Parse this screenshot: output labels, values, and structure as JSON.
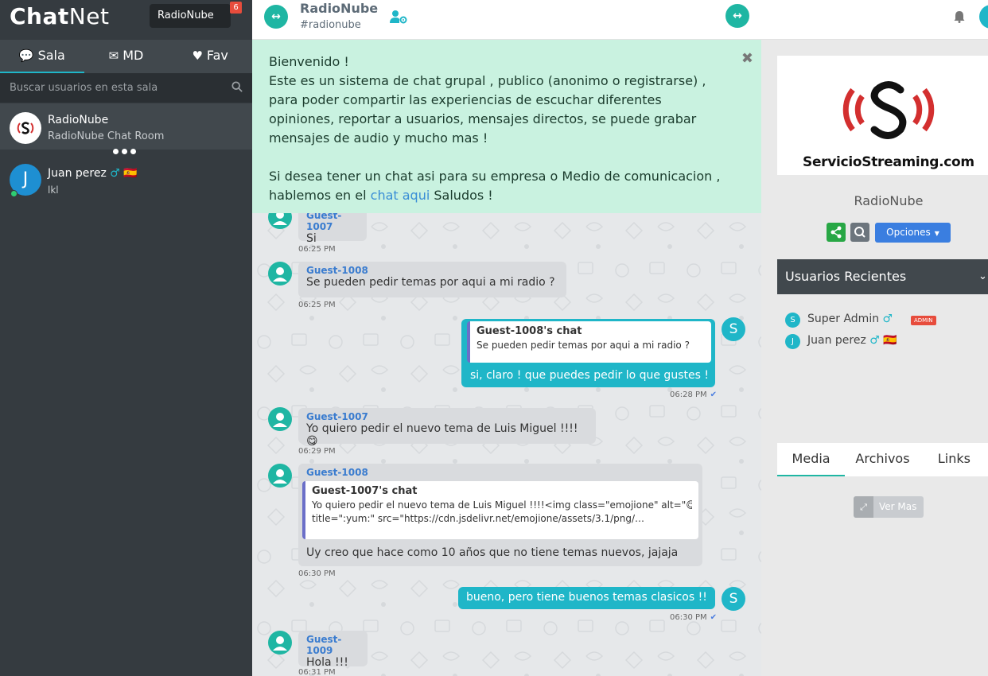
{
  "brand": {
    "part1": "Chat",
    "part2": "Net"
  },
  "room_pill": {
    "label": "RadioNube",
    "badge": "6"
  },
  "sidebar": {
    "tabs": [
      {
        "label": "Sala",
        "icon": "comments-icon"
      },
      {
        "label": "MD",
        "icon": "envelope-icon"
      },
      {
        "label": "Fav",
        "icon": "heart-icon"
      }
    ],
    "search_placeholder": "Buscar usuarios en esta sala",
    "room": {
      "name": "RadioNube",
      "subtitle": "RadioNube Chat Room"
    },
    "user": {
      "initial": "J",
      "name": "Juan perez",
      "gender": "♂",
      "flag": "🇪🇸",
      "status": "lkl"
    }
  },
  "topbar": {
    "title": "RadioNube",
    "handle": "#radionube"
  },
  "welcome": {
    "line1": "Bienvenido !",
    "line2": "Este es un sistema de chat grupal , publico (anonimo o registrarse) , para poder compartir las experiencias de escuchar diferentes opiniones, reportar a usuarios, mensajes directos, se puede grabar mensajes de audio y mucho mas !",
    "line3_pre": "Si desea tener un chat asi para su empresa o Medio de comunicacion , hablemos en el",
    "link": "chat aqui",
    "line3_post": "Saludos !",
    "close": "✖"
  },
  "messages": {
    "m1": {
      "user": "Guest-1007",
      "text": "Si",
      "time": "06:25 PM"
    },
    "m2": {
      "user": "Guest-1008",
      "text": "Se pueden pedir temas por aqui a mi radio ?",
      "time": "06:25 PM"
    },
    "m3": {
      "quote_title": "Guest-1008's chat",
      "quote_body": "Se pueden pedir temas por aqui a mi radio ?",
      "text": "si, claro ! que puedes pedir lo que gustes !",
      "time": "06:28 PM",
      "avatar": "S"
    },
    "m4": {
      "user": "Guest-1007",
      "text": "Yo quiero pedir el nuevo tema de Luis Miguel !!!!😋",
      "time": "06:29 PM"
    },
    "m5": {
      "user": "Guest-1008",
      "quote_title": "Guest-1007's chat",
      "quote_line1": "Yo quiero pedir el nuevo tema de Luis Miguel !!!!<img class=\"emojione\" alt=\"😋\"",
      "quote_line2": "title=\":yum:\" src=\"https://cdn.jsdelivr.net/emojione/assets/3.1/png/…",
      "text": "Uy creo que hace como 10 años que no tiene temas nuevos, jajaja",
      "time": "06:30 PM"
    },
    "m6": {
      "text": "bueno, pero tiene buenos temas clasicos !!",
      "time": "06:30 PM",
      "avatar": "S"
    },
    "m7": {
      "user": "Guest-1009",
      "text": "Hola !!!",
      "time": "06:31 PM"
    }
  },
  "right_panel": {
    "logo_text": "ServicioStreaming.com",
    "room_name": "RadioNube",
    "options_label": "Opciones",
    "recent_title": "Usuarios Recientes",
    "recent_users": [
      {
        "initial": "S",
        "name": "Super Admin",
        "gender": "♂",
        "badge": "ADMIN"
      },
      {
        "initial": "J",
        "name": "Juan perez",
        "gender": "♂",
        "flag": "🇪🇸"
      }
    ],
    "media_tabs": [
      "Media",
      "Archivos",
      "Links"
    ],
    "ver_mas": "Ver Mas"
  },
  "colors": {
    "accent": "#1fb6c8",
    "green": "#1fb6a3",
    "sidebar": "#353b40"
  }
}
